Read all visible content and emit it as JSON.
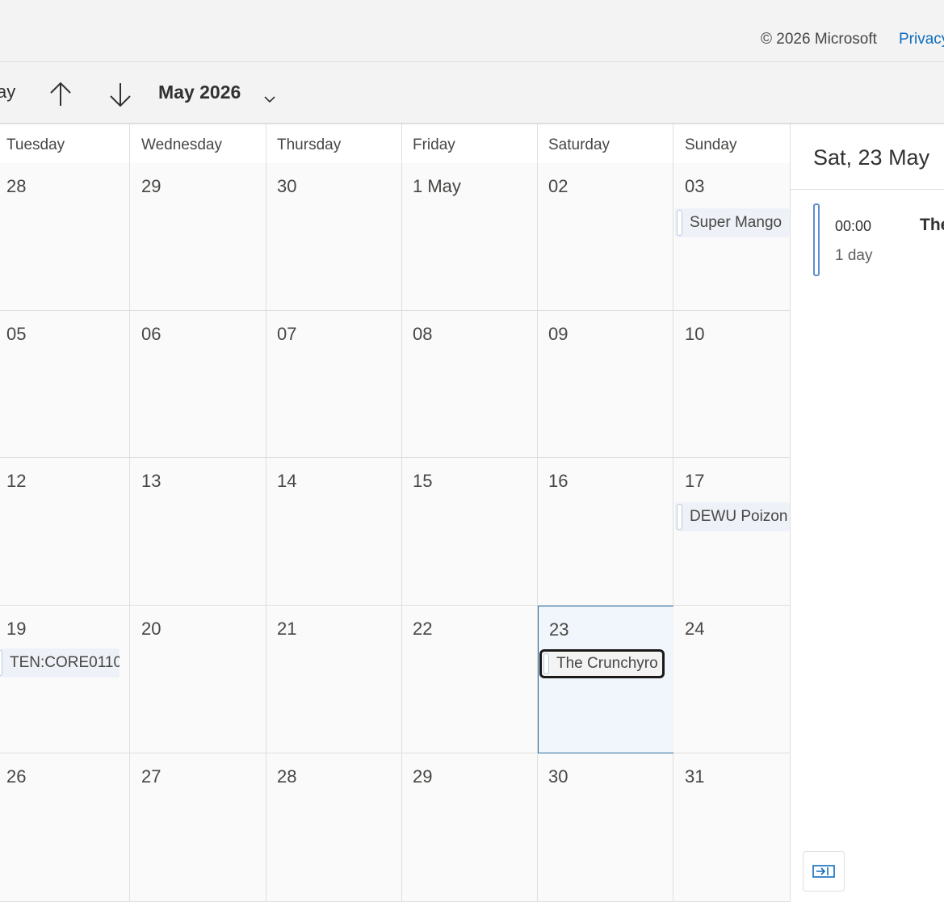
{
  "footer": {
    "copyright": "© 2026 Microsoft",
    "privacy_link": "Privacy"
  },
  "toolbar": {
    "today_partial": "ay",
    "month_label": "May 2026",
    "icons": [
      "arrow-up-icon",
      "arrow-down-icon",
      "chevron-down-icon"
    ]
  },
  "calendar": {
    "day_names": [
      "Tuesday",
      "Wednesday",
      "Thursday",
      "Friday",
      "Saturday",
      "Sunday"
    ],
    "weeks": [
      [
        "28",
        "29",
        "30",
        "1 May",
        "02",
        "03"
      ],
      [
        "05",
        "06",
        "07",
        "08",
        "09",
        "10"
      ],
      [
        "12",
        "13",
        "14",
        "15",
        "16",
        "17"
      ],
      [
        "19",
        "20",
        "21",
        "22",
        "23",
        "24"
      ],
      [
        "26",
        "27",
        "28",
        "29",
        "30",
        "31"
      ]
    ],
    "selected_date": "23",
    "events": {
      "sun_03": "Super Mango",
      "sun_17": "DEWU Poizon",
      "tue_19": "TEN:CORE0110",
      "sat_23": "The Crunchyro"
    }
  },
  "side_panel": {
    "title": "Sat, 23 May",
    "agenda": {
      "time": "00:00",
      "duration": "1 day",
      "title_partial": "The"
    },
    "collapse_icon": "collapse-pane-icon"
  },
  "colors": {
    "accent": "#0f6cbd",
    "selected_border": "#2b6ca3",
    "selected_bg": "#f0f6fb",
    "grid_line": "#e1dfdd"
  }
}
